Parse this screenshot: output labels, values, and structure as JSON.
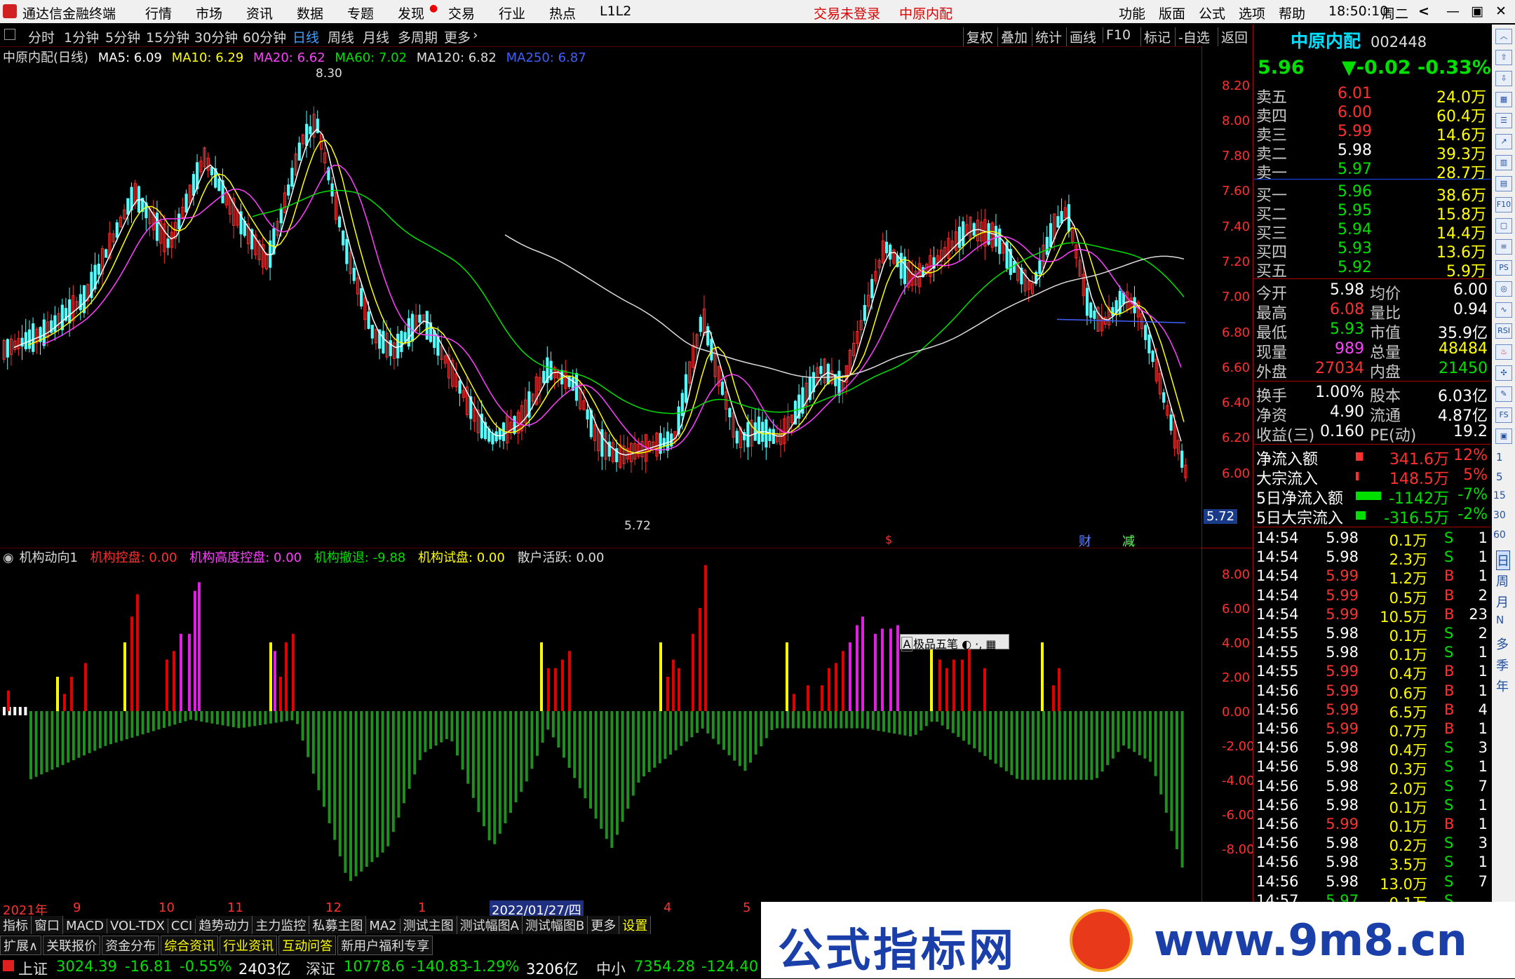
{
  "app": {
    "title": "通达信金融终端"
  },
  "menu_left": [
    "行情",
    "市场",
    "资讯",
    "数据",
    "专题",
    "发现",
    "交易",
    "行业",
    "热点",
    "L1L2"
  ],
  "menu_mid": {
    "login": "交易未登录",
    "stock": "中原内配"
  },
  "menu_right": [
    "功能",
    "版面",
    "公式",
    "选项",
    "帮助"
  ],
  "clock": "18:50:10",
  "weekday": "周二",
  "periods": [
    "分时",
    "1分钟",
    "5分钟",
    "15分钟",
    "30分钟",
    "60分钟",
    "日线",
    "周线",
    "月线",
    "多周期",
    "更多"
  ],
  "active_period": "日线",
  "chart_tools": [
    "复权",
    "叠加",
    "统计",
    "画线",
    "F10",
    "标记",
    "-自选",
    "返回"
  ],
  "ma_bar": {
    "name": "中原内配(日线)",
    "ma5": "MA5: 6.09",
    "ma10": "MA10: 6.29",
    "ma20": "MA20: 6.62",
    "ma60": "MA60: 7.02",
    "ma120": "MA120: 6.82",
    "ma250": "MA250: 6.87"
  },
  "main_axis": [
    "8.20",
    "8.00",
    "7.80",
    "7.60",
    "7.40",
    "7.20",
    "7.00",
    "6.80",
    "6.60",
    "6.40",
    "6.20",
    "6.00"
  ],
  "high_label": "8.30",
  "low_label": "5.72",
  "last_price_tag": "5.72",
  "event_marks": {
    "cai": "财",
    "jian": "减"
  },
  "indicator": {
    "name": "机构动向1",
    "kongpan": "机构控盘: 0.00",
    "gaodu": "机构高度控盘: 0.00",
    "chetui": "机构撤退: -9.88",
    "shipan": "机构试盘: 0.00",
    "sanhu": "散户活跃: 0.00"
  },
  "ind_axis": [
    "8.00",
    "6.00",
    "4.00",
    "2.00",
    "0.00",
    "-2.00",
    "-4.00",
    "-6.00",
    "-8.00"
  ],
  "popup": "极品五笔",
  "dates": [
    "2021年",
    "9",
    "10",
    "11",
    "12",
    "1",
    "2022/01/27/四",
    "4",
    "5"
  ],
  "tabs": [
    "指标",
    "窗口",
    "MACD",
    "VOL-TDX",
    "CCI",
    "趋势动力",
    "主力监控",
    "私募主图",
    "MA2",
    "测试主图",
    "测试幅图A",
    "测试幅图B",
    "更多",
    "设置"
  ],
  "tabs2": [
    "扩展∧",
    "关联报价",
    "资金分布",
    "综合资讯",
    "行业资讯",
    "互动问答",
    "新用户福利专享"
  ],
  "status": {
    "sh": "上证",
    "sh_v": "3024.39",
    "sh_c": "-16.81",
    "sh_p": "-0.55%",
    "sh_a": "2403亿",
    "sz": "深证",
    "sz_v": "10778.6",
    "sz_c": "-140.83",
    "sz_p": "-1.29%",
    "sz_a": "3206亿",
    "zx": "中小",
    "zx_v": "7354.28",
    "zx_c": "-124.40"
  },
  "quote": {
    "name": "中原内配",
    "code": "002448",
    "price": "5.96",
    "change": "▼-0.02",
    "pct": "-0.33%"
  },
  "sells": [
    [
      "卖五",
      "6.01",
      "24.0万"
    ],
    [
      "卖四",
      "6.00",
      "60.4万"
    ],
    [
      "卖三",
      "5.99",
      "14.6万"
    ],
    [
      "卖二",
      "5.98",
      "39.3万"
    ],
    [
      "卖一",
      "5.97",
      "28.7万"
    ]
  ],
  "buys": [
    [
      "买一",
      "5.96",
      "38.6万"
    ],
    [
      "买二",
      "5.95",
      "15.8万"
    ],
    [
      "买三",
      "5.94",
      "14.4万"
    ],
    [
      "买四",
      "5.93",
      "13.6万"
    ],
    [
      "买五",
      "5.92",
      "5.9万"
    ]
  ],
  "stats": [
    [
      "今开",
      "5.98",
      "均价",
      "6.00"
    ],
    [
      "最高",
      "6.08",
      "量比",
      "0.94"
    ],
    [
      "最低",
      "5.93",
      "市值",
      "35.9亿"
    ],
    [
      "现量",
      "989",
      "总量",
      "48484"
    ],
    [
      "外盘",
      "27034",
      "内盘",
      "21450"
    ]
  ],
  "stats2": [
    [
      "换手",
      "1.00%",
      "股本",
      "6.03亿"
    ],
    [
      "净资",
      "4.90",
      "流通",
      "4.87亿"
    ],
    [
      "收益(三)",
      "0.160",
      "PE(动)",
      "19.2"
    ]
  ],
  "flows": [
    [
      "净流入额",
      "341.6万",
      "12%"
    ],
    [
      "大宗流入",
      "148.5万",
      "5%"
    ],
    [
      "5日净流入额",
      "-1142万",
      "-7%"
    ],
    [
      "5日大宗流入",
      "-316.5万",
      "-2%"
    ]
  ],
  "ticks": [
    [
      "14:54",
      "5.98",
      "0.1万",
      "S",
      "1"
    ],
    [
      "14:54",
      "5.98",
      "2.3万",
      "S",
      "1"
    ],
    [
      "14:54",
      "5.99",
      "1.2万",
      "B",
      "1"
    ],
    [
      "14:54",
      "5.99",
      "0.5万",
      "B",
      "2"
    ],
    [
      "14:54",
      "5.99",
      "10.5万",
      "B",
      "23"
    ],
    [
      "14:55",
      "5.98",
      "0.1万",
      "S",
      "2"
    ],
    [
      "14:55",
      "5.98",
      "0.1万",
      "S",
      "1"
    ],
    [
      "14:55",
      "5.99",
      "0.4万",
      "B",
      "1"
    ],
    [
      "14:56",
      "5.99",
      "0.6万",
      "B",
      "1"
    ],
    [
      "14:56",
      "5.99",
      "6.5万",
      "B",
      "4"
    ],
    [
      "14:56",
      "5.99",
      "0.7万",
      "B",
      "1"
    ],
    [
      "14:56",
      "5.98",
      "0.4万",
      "S",
      "3"
    ],
    [
      "14:56",
      "5.98",
      "0.3万",
      "S",
      "1"
    ],
    [
      "14:56",
      "5.98",
      "2.0万",
      "S",
      "7"
    ],
    [
      "14:56",
      "5.98",
      "0.1万",
      "S",
      "1"
    ],
    [
      "14:56",
      "5.99",
      "0.1万",
      "B",
      "1"
    ],
    [
      "14:56",
      "5.98",
      "0.2万",
      "S",
      "3"
    ],
    [
      "14:56",
      "5.98",
      "3.5万",
      "S",
      "1"
    ],
    [
      "14:56",
      "5.98",
      "13.0万",
      "S",
      "7"
    ],
    [
      "14:57",
      "5.97",
      "0.1万",
      "S",
      ""
    ]
  ],
  "side_labels": [
    "日",
    "周",
    "月",
    "N",
    "多",
    "季",
    "年"
  ],
  "banner": {
    "left": "公式指标网",
    "right": "www.9m8.cn"
  }
}
